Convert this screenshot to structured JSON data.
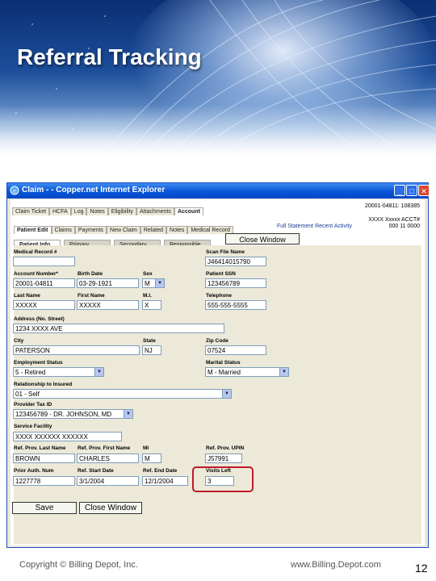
{
  "slide": {
    "title": "Referral Tracking",
    "copyright": "Copyright © Billing Depot, Inc.",
    "website": "www.Billing.Depot.com",
    "page_number": "12"
  },
  "window": {
    "title": "Claim - - Copper.net Internet Explorer",
    "buttons": {
      "minimize": "_",
      "maximize": "□",
      "close": "✕"
    }
  },
  "tabs_top": [
    "Claim Ticket",
    "HCFA",
    "Log",
    "Notes",
    "Eligibility",
    "Attachments",
    "Account"
  ],
  "tabs_top_active": "Account",
  "claim_id": "20001-04811: 108385",
  "tabs_second": [
    "Patient Edit",
    "Claims",
    "Payments",
    "New Claim",
    "Related",
    "Notes",
    "Medical Record"
  ],
  "patient_link": "Full Statement  Recent Activity",
  "address_lines": [
    "XXXX Xxxxx ACCT#",
    "000 11 0000"
  ],
  "tabs_third": [
    "Patient Info",
    "Primary",
    "Secondary",
    "Responsible"
  ],
  "close_window_top": "Close Window",
  "form": {
    "medical_record_label": "Medical Record #",
    "medical_record_value": "",
    "scan_file_label": "Scan File Name",
    "scan_file_value": "J46414015790",
    "account_number_label": "Account Number*",
    "account_number_value": "20001-04811",
    "birth_date_label": "Birth Date",
    "birth_date_value": "03-29-1921",
    "sex_label": "Sex",
    "sex_value": "M",
    "patient_ssn_label": "Patient SSN",
    "patient_ssn_value": "123456789",
    "last_name_label": "Last Name",
    "last_name_value": "XXXXX",
    "first_name_label": "First Name",
    "first_name_value": "XXXXX",
    "mi_label": "M.I.",
    "mi_value": "X",
    "telephone_label": "Telephone",
    "telephone_value": "555-555-5555",
    "address_label": "Address (No. Street)",
    "address_value": "1234 XXXX AVE",
    "city_label": "City",
    "city_value": "PATERSON",
    "state_label": "State",
    "state_value": "NJ",
    "zip_label": "Zip Code",
    "zip_value": "07524",
    "employment_label": "Employment Status",
    "employment_value": "5 - Retired",
    "marital_label": "Marital Status",
    "marital_value": "M - Married",
    "relationship_label": "Relationship to Insured",
    "relationship_value": "01 - Self",
    "provider_tax_label": "Provider Tax ID",
    "provider_tax_value": "123456789 - DR. JOHNSON, MD",
    "service_facility_label": "Service Facility",
    "service_facility_value": "XXXX XXXXXX XXXXXX",
    "ref_last_label": "Ref. Prov. Last Name",
    "ref_last_value": "BROWN",
    "ref_first_label": "Ref. Prov. First Name",
    "ref_first_value": "CHARLES",
    "ref_mi_label": "MI",
    "ref_mi_value": "M",
    "ref_upin_label": "Ref. Prov. UPIN",
    "ref_upin_value": "J57991",
    "prior_auth_label": "Prior Auth. Num",
    "prior_auth_value": "1227778",
    "ref_start_label": "Ref. Start Date",
    "ref_start_value": "3/1/2004",
    "ref_end_label": "Ref. End Date",
    "ref_end_value": "12/1/2004",
    "visits_left_label": "Visits Left",
    "visits_left_value": "3",
    "save_button": "Save",
    "close_window_button": "Close Window"
  },
  "colors": {
    "highlight": "#c2182b",
    "titlebar": "#0a58d8",
    "window_bg": "#ece9d8"
  }
}
